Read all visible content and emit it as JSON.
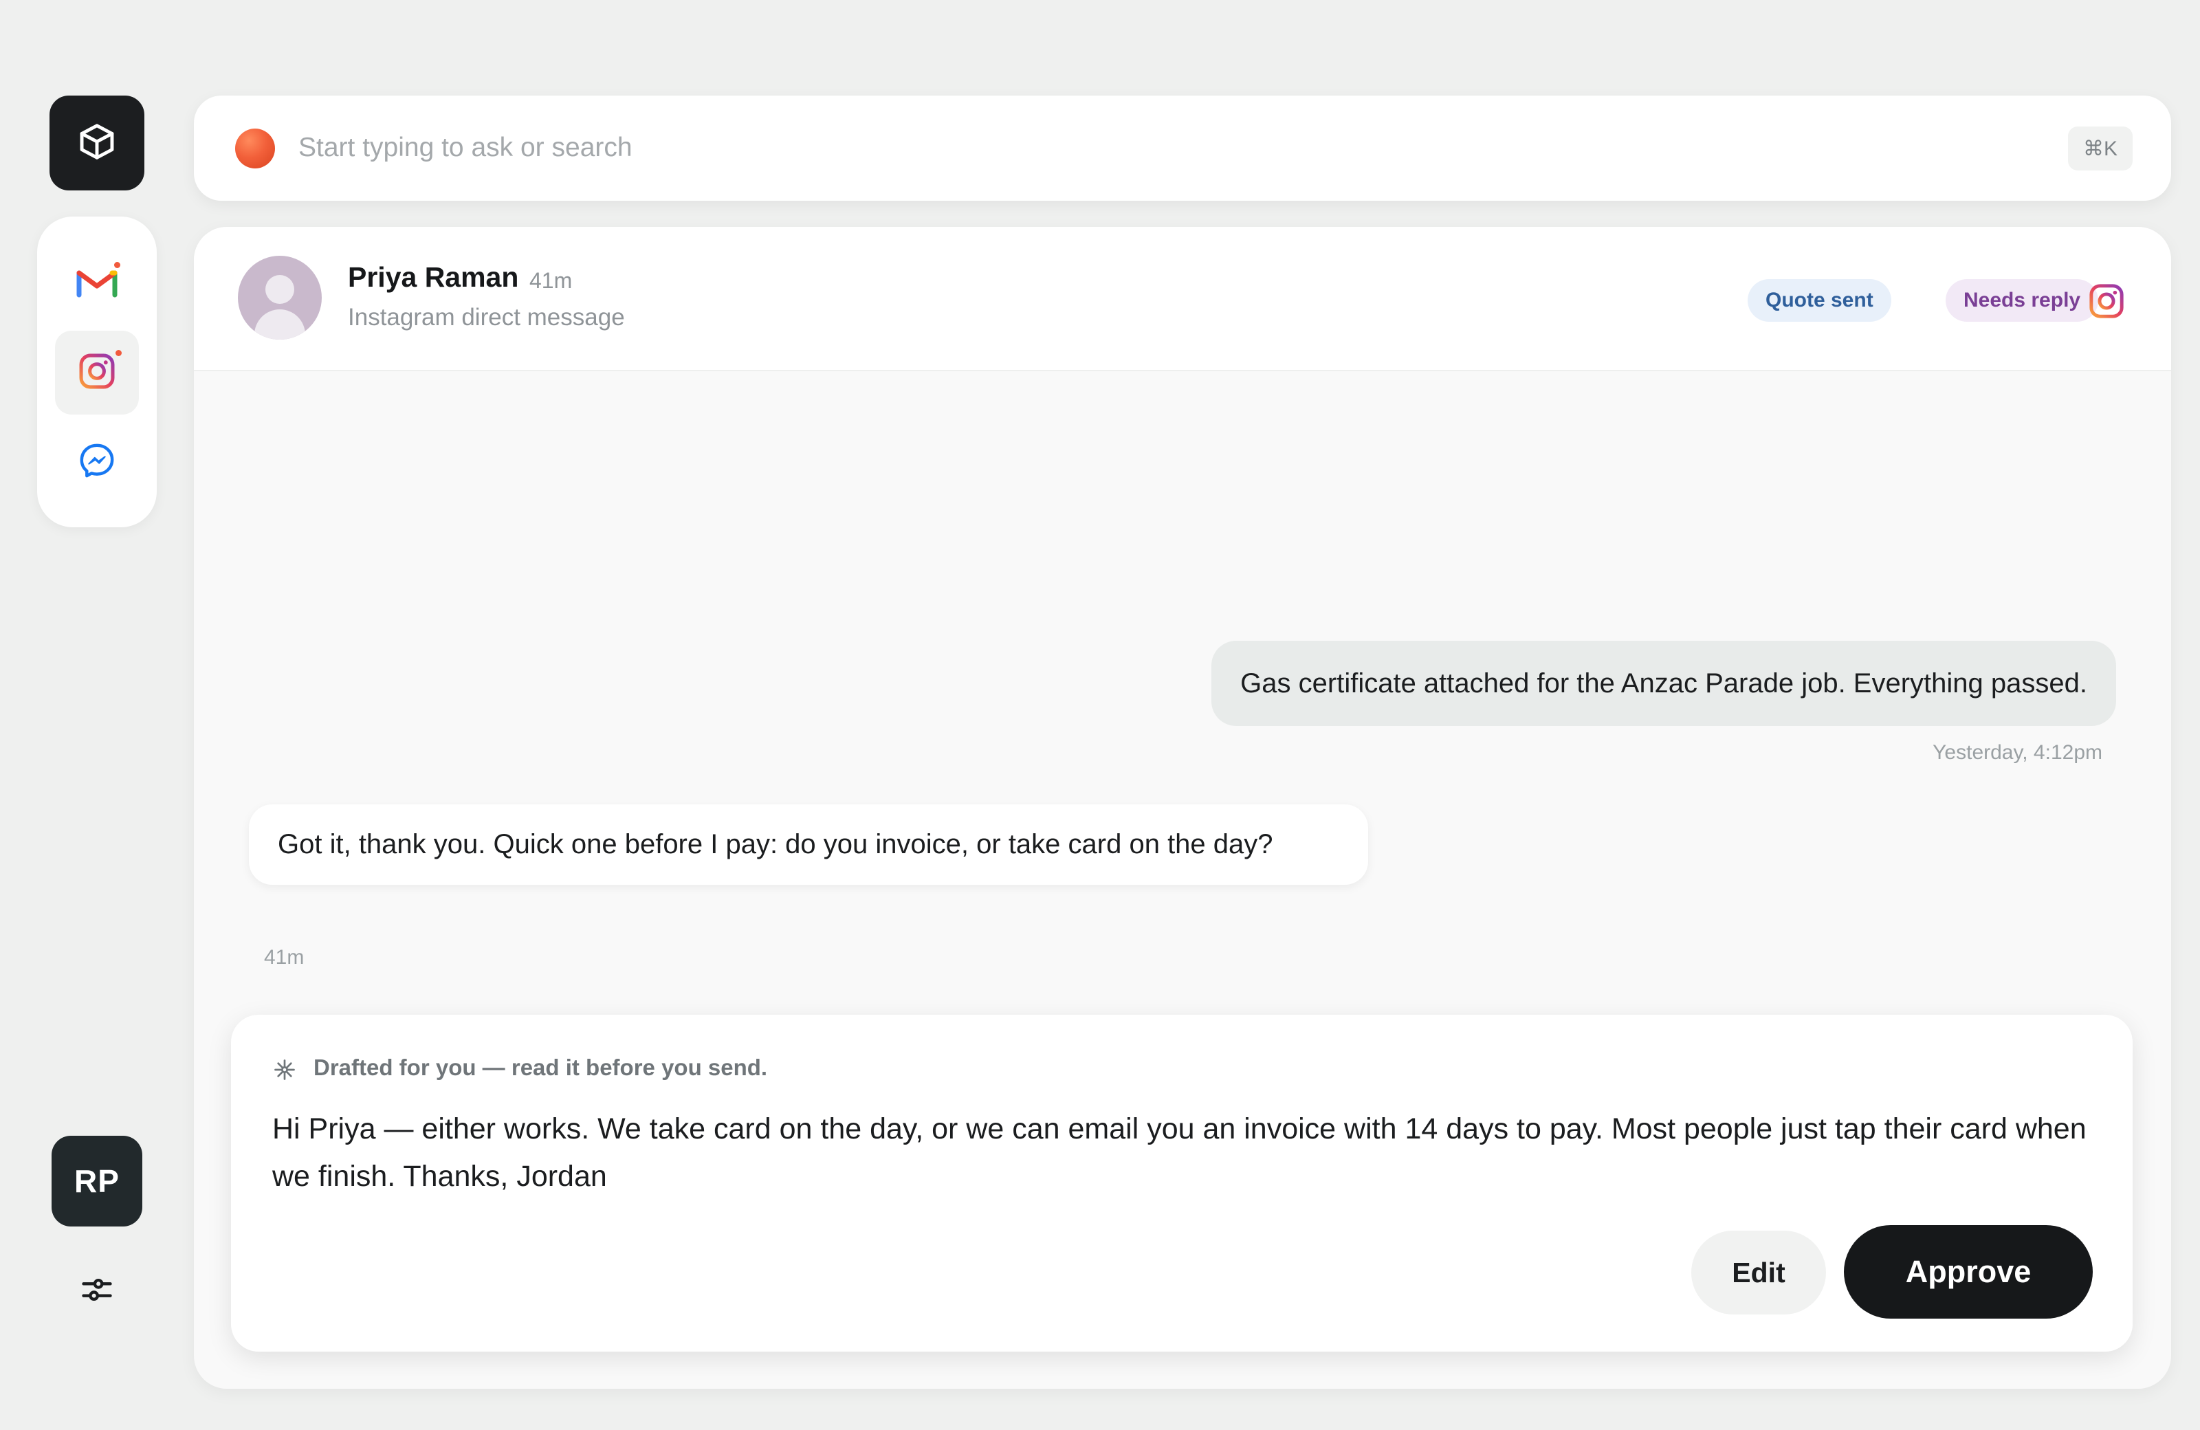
{
  "app": {
    "logo_icon": "cube-icon",
    "user_initials": "RP",
    "settings_icon": "sliders-icon"
  },
  "channels": [
    {
      "name": "Gmail",
      "icon": "gmail-icon",
      "unread": true,
      "active": false
    },
    {
      "name": "Instagram",
      "icon": "instagram-icon",
      "unread": true,
      "active": true
    },
    {
      "name": "Messenger",
      "icon": "messenger-icon",
      "unread": false,
      "active": false
    }
  ],
  "search": {
    "placeholder": "Start typing to ask or search",
    "shortcut": "⌘K",
    "orb_color": "#f2603a"
  },
  "conversation": {
    "contact_name": "Priya Raman",
    "time_ago": "41m",
    "source": "Instagram direct message",
    "tags": [
      {
        "label": "Quote sent",
        "color": "#2f5f9b",
        "background": "#e8f0fa"
      },
      {
        "label": "Needs reply",
        "color": "#7a3f95",
        "background": "#f2e9f6"
      }
    ],
    "channel_icon": "instagram-icon",
    "messages": [
      {
        "direction": "outgoing",
        "text": "Gas certificate attached for the Anzac Parade job. Everything passed.",
        "time": "Yesterday, 4:12pm"
      },
      {
        "direction": "incoming",
        "text": "Got it, thank you. Quick one before I pay: do you invoice, or take card on the day?",
        "time": "41m"
      }
    ]
  },
  "draft": {
    "icon": "sparkle-icon",
    "label": "Drafted for you — read it before you send.",
    "text": "Hi Priya — either works. We take card on the day, or we can email you an invoice with 14 days to pay. Most people just tap their card when we finish. Thanks, Jordan",
    "edit_label": "Edit",
    "approve_label": "Approve"
  }
}
